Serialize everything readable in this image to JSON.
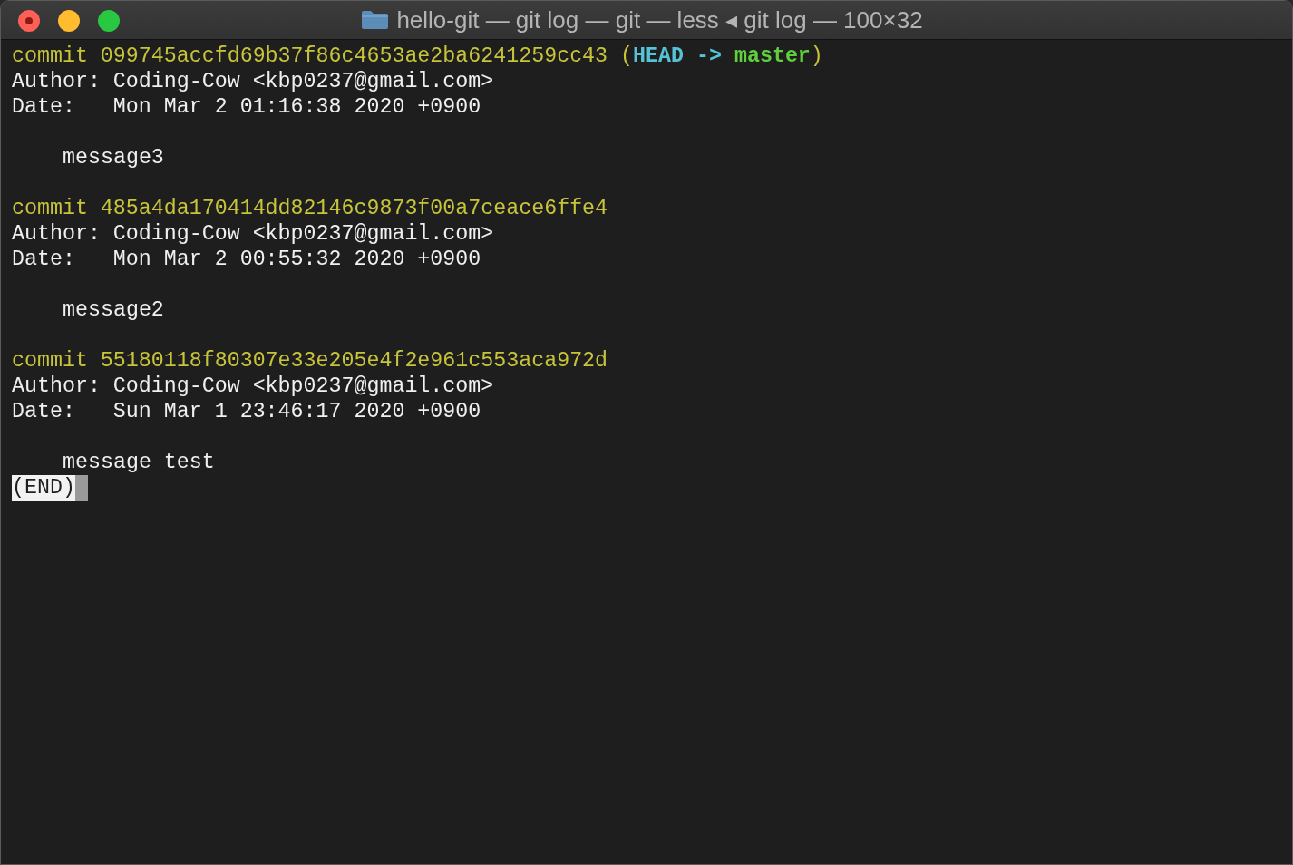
{
  "window": {
    "title": "hello-git — git log — git — less ◂ git log — 100×32"
  },
  "commits": [
    {
      "hash_line": "commit 099745accfd69b37f86c4653ae2ba6241259cc43",
      "refs": [
        {
          "kind": "paren",
          "text": "("
        },
        {
          "kind": "head",
          "text": "HEAD"
        },
        {
          "kind": "arrow",
          "text": "->"
        },
        {
          "kind": "branch",
          "text": "master"
        },
        {
          "kind": "paren",
          "text": ")"
        }
      ],
      "author_line": "Author: Coding-Cow <kbp0237@gmail.com>",
      "date_line": "Date:   Mon Mar 2 01:16:38 2020 +0900",
      "message": "message3"
    },
    {
      "hash_line": "commit 485a4da170414dd82146c9873f00a7ceace6ffe4",
      "author_line": "Author: Coding-Cow <kbp0237@gmail.com>",
      "date_line": "Date:   Mon Mar 2 00:55:32 2020 +0900",
      "message": "message2"
    },
    {
      "hash_line": "commit 55180118f80307e33e205e4f2e961c553aca972d",
      "author_line": "Author: Coding-Cow <kbp0237@gmail.com>",
      "date_line": "Date:   Sun Mar 1 23:46:17 2020 +0900",
      "message": "message test"
    }
  ],
  "pager_prompt": "(END)"
}
